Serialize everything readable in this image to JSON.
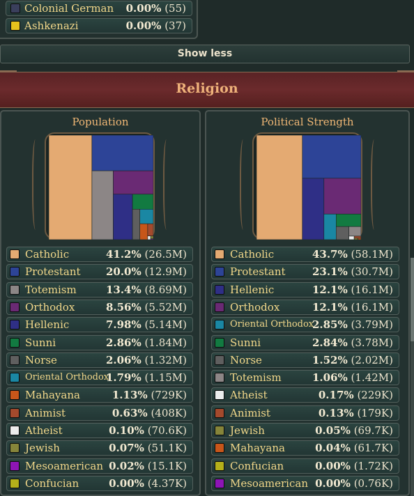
{
  "ethnicities": [
    {
      "name": "Colonial German",
      "pct": "0.00%",
      "count": "(55)",
      "color": "#3a3f5c"
    },
    {
      "name": "Ashkenazi",
      "pct": "0.00%",
      "count": "(37)",
      "color": "#e5c21d"
    }
  ],
  "show_less_label": "Show less",
  "section_title": "Religion",
  "population": {
    "title": "Population",
    "items": [
      {
        "name": "Catholic",
        "pct": "41.2%",
        "count": "(26.5M)",
        "color": "#e4aa72",
        "value": 41.2
      },
      {
        "name": "Protestant",
        "pct": "20.0%",
        "count": "(12.9M)",
        "color": "#2d4497",
        "value": 20.0
      },
      {
        "name": "Totemism",
        "pct": "13.4%",
        "count": "(8.69M)",
        "color": "#8c8686",
        "value": 13.4
      },
      {
        "name": "Orthodox",
        "pct": "8.56%",
        "count": "(5.52M)",
        "color": "#6a2a74",
        "value": 8.56
      },
      {
        "name": "Hellenic",
        "pct": "7.98%",
        "count": "(5.14M)",
        "color": "#2f2f86",
        "value": 7.98
      },
      {
        "name": "Sunni",
        "pct": "2.86%",
        "count": "(1.84M)",
        "color": "#127a41",
        "value": 2.86
      },
      {
        "name": "Norse",
        "pct": "2.06%",
        "count": "(1.32M)",
        "color": "#5f5f5f",
        "value": 2.06
      },
      {
        "name": "Oriental Orthodox",
        "pct": "1.79%",
        "count": "(1.15M)",
        "color": "#1a87a3",
        "value": 1.79,
        "small": true
      },
      {
        "name": "Mahayana",
        "pct": "1.13%",
        "count": "(729K)",
        "color": "#c7561a",
        "value": 1.13
      },
      {
        "name": "Animist",
        "pct": "0.63%",
        "count": "(408K)",
        "color": "#a44a2d",
        "value": 0.63
      },
      {
        "name": "Atheist",
        "pct": "0.10%",
        "count": "(70.6K)",
        "color": "#ececec",
        "value": 0.1
      },
      {
        "name": "Jewish",
        "pct": "0.07%",
        "count": "(51.1K)",
        "color": "#86853a",
        "value": 0.07
      },
      {
        "name": "Mesoamerican",
        "pct": "0.02%",
        "count": "(15.1K)",
        "color": "#8d15b5",
        "value": 0.02
      },
      {
        "name": "Confucian",
        "pct": "0.00%",
        "count": "(4.37K)",
        "color": "#b4b01a",
        "value": 0.0
      }
    ]
  },
  "political": {
    "title": "Political Strength",
    "items": [
      {
        "name": "Catholic",
        "pct": "43.7%",
        "count": "(58.1M)",
        "color": "#e4aa72",
        "value": 43.7
      },
      {
        "name": "Protestant",
        "pct": "23.1%",
        "count": "(30.7M)",
        "color": "#2d4497",
        "value": 23.1
      },
      {
        "name": "Hellenic",
        "pct": "12.1%",
        "count": "(16.1M)",
        "color": "#2f2f86",
        "value": 12.1
      },
      {
        "name": "Orthodox",
        "pct": "12.1%",
        "count": "(16.1M)",
        "color": "#6a2a74",
        "value": 12.1
      },
      {
        "name": "Oriental Orthodox",
        "pct": "2.85%",
        "count": "(3.79M)",
        "color": "#1a87a3",
        "value": 2.85,
        "small": true
      },
      {
        "name": "Sunni",
        "pct": "2.84%",
        "count": "(3.78M)",
        "color": "#127a41",
        "value": 2.84
      },
      {
        "name": "Norse",
        "pct": "1.52%",
        "count": "(2.02M)",
        "color": "#5f5f5f",
        "value": 1.52
      },
      {
        "name": "Totemism",
        "pct": "1.06%",
        "count": "(1.42M)",
        "color": "#8c8686",
        "value": 1.06
      },
      {
        "name": "Atheist",
        "pct": "0.17%",
        "count": "(229K)",
        "color": "#ececec",
        "value": 0.17
      },
      {
        "name": "Animist",
        "pct": "0.13%",
        "count": "(179K)",
        "color": "#a44a2d",
        "value": 0.13
      },
      {
        "name": "Jewish",
        "pct": "0.05%",
        "count": "(69.7K)",
        "color": "#86853a",
        "value": 0.05
      },
      {
        "name": "Mahayana",
        "pct": "0.04%",
        "count": "(61.7K)",
        "color": "#c7561a",
        "value": 0.04
      },
      {
        "name": "Confucian",
        "pct": "0.00%",
        "count": "(1.72K)",
        "color": "#b4b01a",
        "value": 0.0
      },
      {
        "name": "Mesoamerican",
        "pct": "0.00%",
        "count": "(0.76K)",
        "color": "#8d15b5",
        "value": 0.0
      }
    ]
  }
}
